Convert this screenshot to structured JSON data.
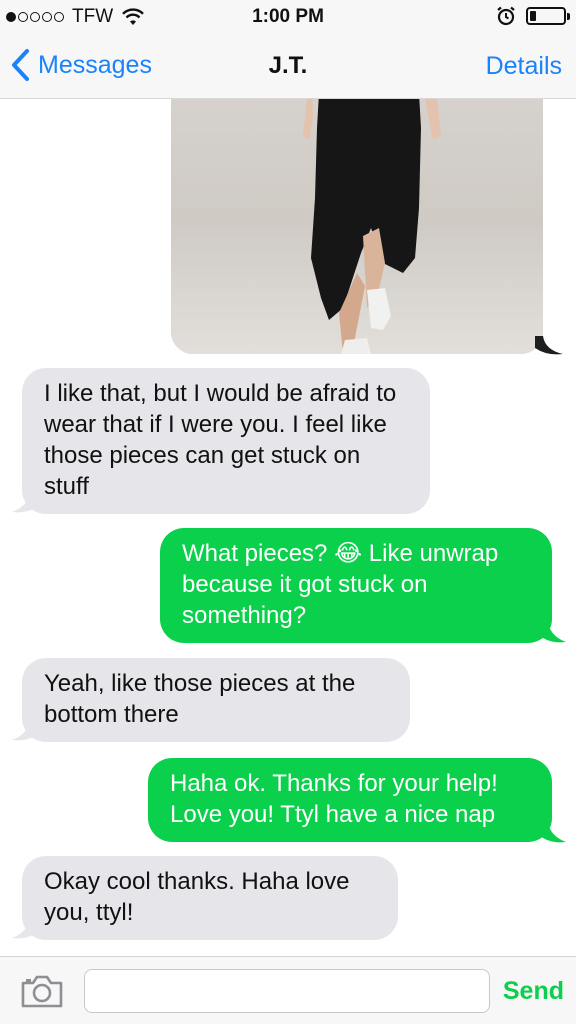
{
  "status_bar": {
    "carrier": "TFW",
    "time": "1:00 PM",
    "signal_icon": "signal-dots-icon",
    "wifi_icon": "wifi-icon",
    "alarm_icon": "alarm-icon",
    "battery_icon": "battery-icon",
    "battery_level": 0.2
  },
  "nav": {
    "back_label": "Messages",
    "title": "J.T.",
    "details_label": "Details",
    "back_icon": "chevron-left-icon"
  },
  "messages": [
    {
      "from": "me",
      "type": "photo"
    },
    {
      "from": "them",
      "text": "I like that, but I would be afraid to wear that if I were you. I feel like those pieces can get stuck on stuff"
    },
    {
      "from": "me",
      "text_before": "What pieces?",
      "emoji": "😂",
      "text_after": "Like unwrap because it got stuck on something?"
    },
    {
      "from": "them",
      "text": "Yeah, like those pieces at the bottom there"
    },
    {
      "from": "me",
      "text": "Haha ok. Thanks for your help! Love you! Ttyl have a nice nap"
    },
    {
      "from": "them",
      "text": "Okay cool thanks. Haha love you, ttyl!"
    }
  ],
  "input": {
    "placeholder": "",
    "send_label": "Send",
    "camera_icon": "camera-icon"
  },
  "colors": {
    "ios_blue": "#1a82fb",
    "sent_green": "#0bd04c",
    "received_gray": "#e5e5ea"
  }
}
